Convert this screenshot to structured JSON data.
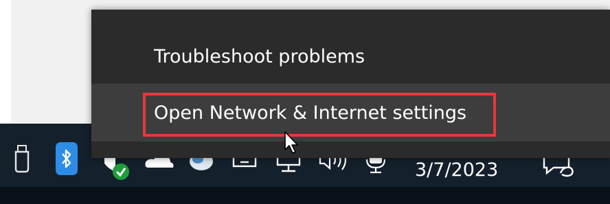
{
  "context_menu": {
    "items": [
      {
        "label": "Troubleshoot problems"
      },
      {
        "label": "Open Network & Internet settings",
        "highlighted": true
      }
    ]
  },
  "taskbar": {
    "tray_icons": [
      "usb-icon",
      "bluetooth-icon",
      "shield-icon",
      "cloud-icon",
      "globe-icon",
      "monitor-icon",
      "network-icon",
      "volume-icon",
      "microphone-icon",
      "notification-icon"
    ],
    "date": "3/7/2023"
  },
  "colors": {
    "menu_background": "#2b2b2b",
    "menu_hover": "#3d3d3d",
    "highlight_border": "#e8383b",
    "taskbar": "#14202b",
    "bluetooth": "#2c8ce6"
  }
}
